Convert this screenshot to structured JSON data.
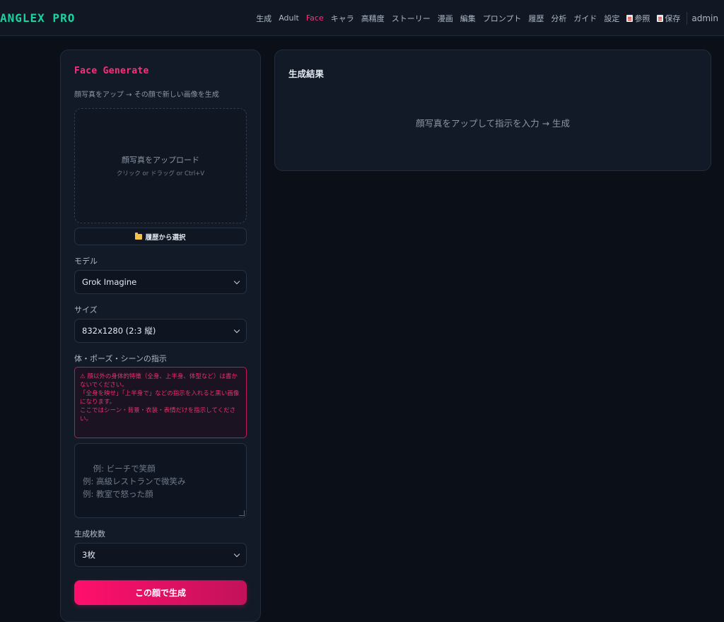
{
  "brand": {
    "logo_text": "ANGLEX PRO"
  },
  "nav": {
    "items": [
      {
        "label": "生成",
        "active": false
      },
      {
        "label": "Adult",
        "active": false
      },
      {
        "label": "Face",
        "active": true
      },
      {
        "label": "キャラ",
        "active": false
      },
      {
        "label": "高精度",
        "active": false
      },
      {
        "label": "ストーリー",
        "active": false
      },
      {
        "label": "漫画",
        "active": false
      },
      {
        "label": "編集",
        "active": false
      },
      {
        "label": "プロンプト",
        "active": false
      },
      {
        "label": "履歴",
        "active": false
      },
      {
        "label": "分析",
        "active": false
      },
      {
        "label": "ガイド",
        "active": false
      },
      {
        "label": "設定",
        "active": false
      }
    ],
    "reference_label": "参照",
    "save_label": "保存",
    "user": "admin"
  },
  "left": {
    "title": "Face Generate",
    "subtitle": "顔写真をアップ → その顔で新しい画像を生成",
    "dropzone": {
      "main": "顔写真をアップロード",
      "sub": "クリック or ドラッグ or Ctrl+V"
    },
    "history_button": "履歴から選択",
    "model": {
      "label": "モデル",
      "value": "Grok Imagine"
    },
    "size": {
      "label": "サイズ",
      "value": "832x1280 (2:3 縦)"
    },
    "instruction": {
      "label": "体・ポーズ・シーンの指示",
      "warning": [
        "⚠ 顔以外の身体的特徴（全身、上半身、体型など）は書かないでください。",
        "「全身を映せ」「上半身で」などの指示を入れると黒い画像になります。",
        "ここではシーン・背景・衣装・表情だけを指示してください。"
      ],
      "placeholder": "例: ビーチで笑顔\n例: 高級レストランで微笑み\n例: 教室で怒った顔"
    },
    "count": {
      "label": "生成枚数",
      "value": "3枚"
    },
    "generate_button": "この顔で生成"
  },
  "right": {
    "title": "生成結果",
    "empty_text": "顔写真をアップして指示を入力 → 生成"
  },
  "colors": {
    "accent": "#ff2d7a",
    "brand": "#19d3a2",
    "background": "#0b0f17",
    "panel": "#121a27"
  }
}
